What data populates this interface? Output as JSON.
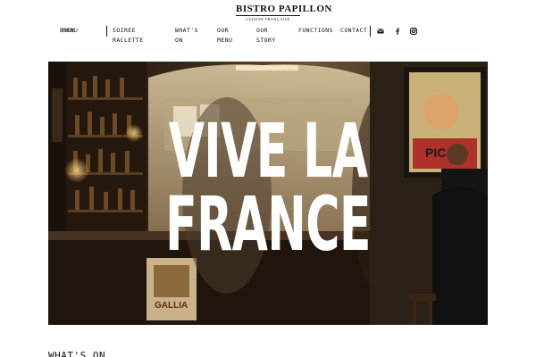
{
  "brand": {
    "name": "BISTRO PAPILLON",
    "tagline": "CUISINE FRANÇAISE"
  },
  "nav": {
    "book": "BOOK",
    "menu_toggle": "MENU",
    "items": [
      {
        "label_line1": "SOIREE",
        "label_line2": "RACLETTE"
      },
      {
        "label_line1": "WHAT'S",
        "label_line2": "ON"
      },
      {
        "label_line1": "OUR",
        "label_line2": "MENU"
      },
      {
        "label_line1": "OUR",
        "label_line2": "STORY"
      },
      {
        "label_line1": "FUNCTIONS",
        "label_line2": ""
      },
      {
        "label_line1": "CONTACT",
        "label_line2": ""
      }
    ],
    "social": [
      "envelope-icon",
      "facebook-icon",
      "instagram-icon"
    ]
  },
  "hero": {
    "headline_line1": "VIVE LA",
    "headline_line2": "FRANCE",
    "poster_text": "PIC",
    "sign_text": "GALLIA"
  },
  "section": {
    "title": "WHAT'S ON"
  },
  "colors": {
    "text": "#111111",
    "background": "#ffffff",
    "hero_text": "#ffffff"
  }
}
